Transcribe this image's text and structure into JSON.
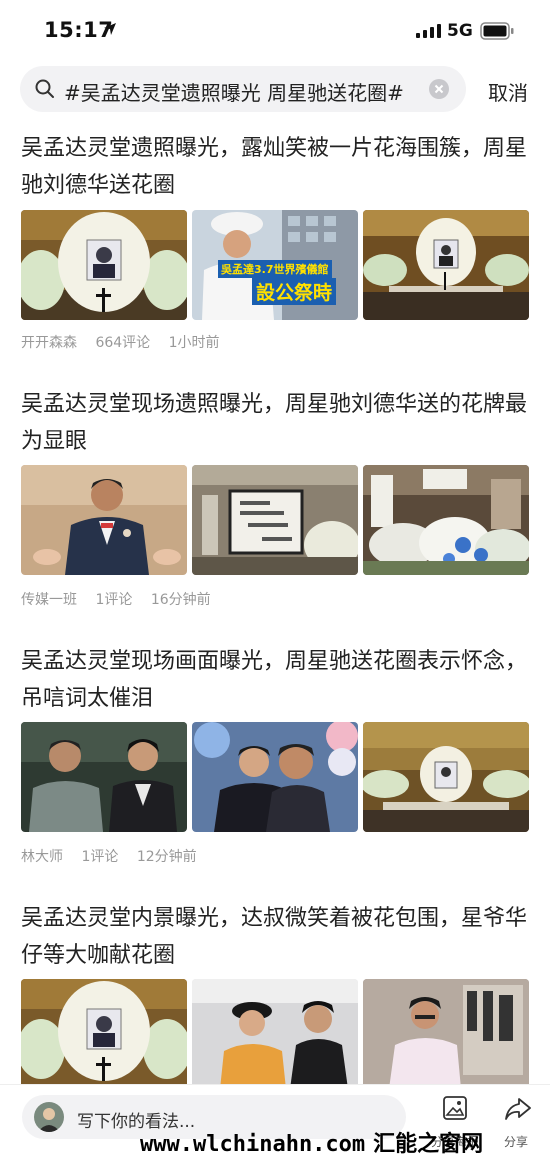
{
  "status": {
    "time": "15:17",
    "network": "5G"
  },
  "search": {
    "query": "#吴孟达灵堂遗照曝光 周星驰送花圈#",
    "cancel_label": "取消"
  },
  "articles": [
    {
      "title": "吴孟达灵堂遗照曝光，露灿笑被一片花海围簇，周星驰刘德华送花圈",
      "source": "开开森森",
      "comments": "664评论",
      "time": "1小时前",
      "image_texts": [
        "吳孟達3.7世界殯儀館",
        "設公祭時"
      ]
    },
    {
      "title": "吴孟达灵堂现场遗照曝光，周星驰刘德华送的花牌最为显眼",
      "source": "传媒一班",
      "comments": "1评论",
      "time": "16分钟前"
    },
    {
      "title": "吴孟达灵堂现场画面曝光，周星驰送花圈表示怀念，吊唁词太催泪",
      "source": "林大师",
      "comments": "1评论",
      "time": "12分钟前"
    },
    {
      "title": "吴孟达灵堂内景曝光，达叔微笑着被花包围，星爷华仔等大咖献花圈"
    }
  ],
  "bottom_bar": {
    "comment_placeholder": "写下你的看法...",
    "poster_label": "分享海报",
    "share_label": "分享"
  },
  "watermark": {
    "url": "www.wlchinahn.com",
    "cn": "汇能之窗网"
  }
}
